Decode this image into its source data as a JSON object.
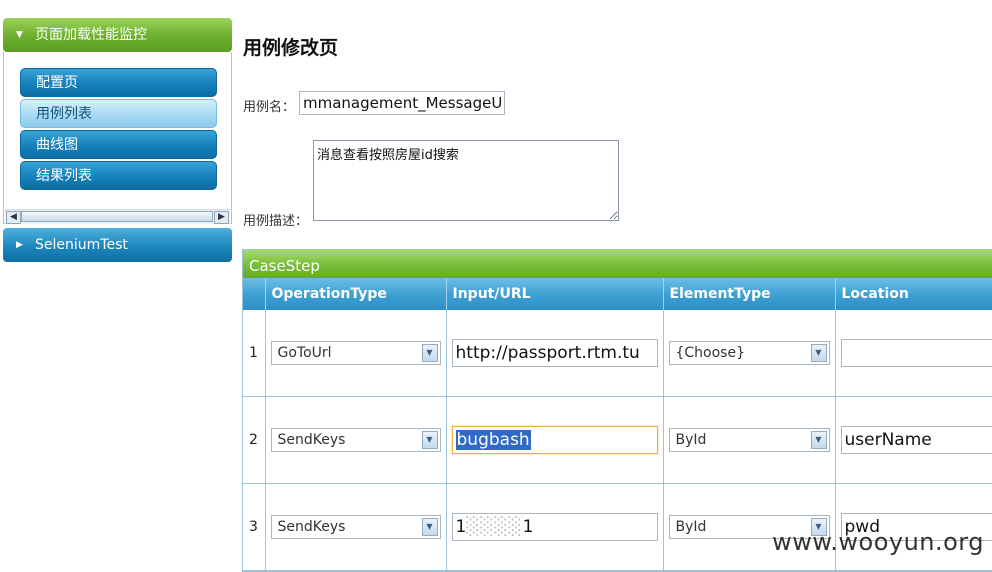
{
  "sidebar": {
    "group1_title": "页面加载性能监控",
    "items": [
      {
        "label": "配置页"
      },
      {
        "label": "用例列表"
      },
      {
        "label": "曲线图"
      },
      {
        "label": "结果列表"
      }
    ],
    "group2_title": "SeleniumTest"
  },
  "page": {
    "title": "用例修改页",
    "name_label": "用例名：",
    "name_value": "mmanagement_MessageUni",
    "desc_label": "用例描述：",
    "desc_value": "消息查看按照房屋id搜索"
  },
  "grid": {
    "caption": "CaseStep",
    "headers": [
      "",
      "OperationType",
      "Input/URL",
      "ElementType",
      "Location"
    ],
    "rows": [
      {
        "num": "1",
        "operation": "GoToUrl",
        "input": "http://passport.rtm.tu",
        "element_type": "{Choose}",
        "location": ""
      },
      {
        "num": "2",
        "operation": "SendKeys",
        "input": "bugbash",
        "element_type": "ById",
        "location": "userName"
      },
      {
        "num": "3",
        "operation": "SendKeys",
        "input_prefix": "1",
        "input_suffix": "1",
        "element_type": "ById",
        "location": "pwd"
      }
    ]
  },
  "watermark": "www.wooyun.org",
  "colors": {
    "header_green": "#78bd3a",
    "header_blue": "#3c9fd2",
    "selection": "#3169c6"
  }
}
